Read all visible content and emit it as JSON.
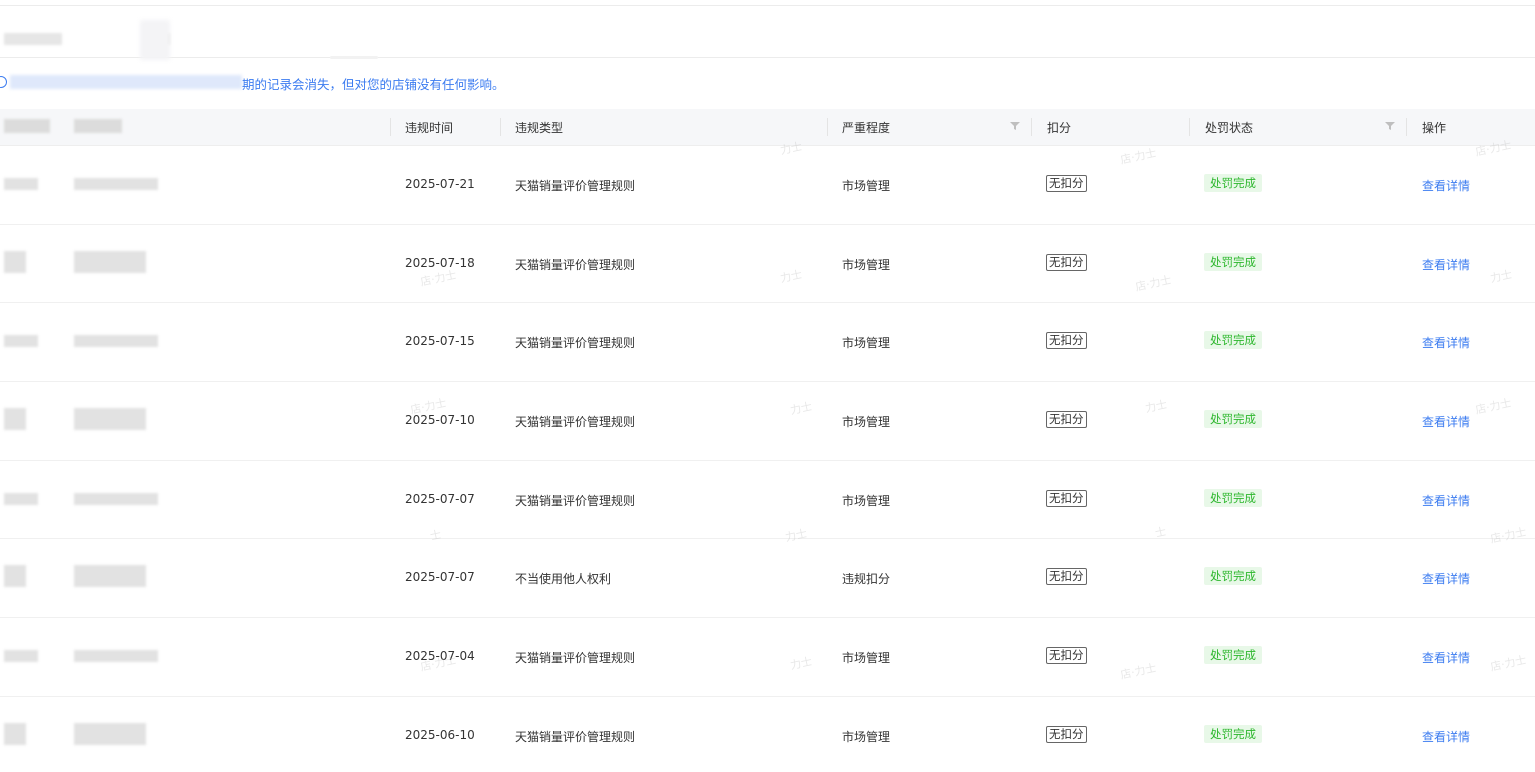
{
  "notice": {
    "text": "期的记录会消失，但对您的店铺没有任何影响。"
  },
  "table": {
    "headers": {
      "time": "违规时间",
      "type": "违规类型",
      "severity": "严重程度",
      "deduct": "扣分",
      "status": "处罚状态",
      "action": "操作"
    },
    "rows": [
      {
        "time": "2025-07-21",
        "type": "天猫销量评价管理规则",
        "severity": "市场管理",
        "deduct": "无扣分",
        "status": "处罚完成",
        "action": "查看详情"
      },
      {
        "time": "2025-07-18",
        "type": "天猫销量评价管理规则",
        "severity": "市场管理",
        "deduct": "无扣分",
        "status": "处罚完成",
        "action": "查看详情"
      },
      {
        "time": "2025-07-15",
        "type": "天猫销量评价管理规则",
        "severity": "市场管理",
        "deduct": "无扣分",
        "status": "处罚完成",
        "action": "查看详情"
      },
      {
        "time": "2025-07-10",
        "type": "天猫销量评价管理规则",
        "severity": "市场管理",
        "deduct": "无扣分",
        "status": "处罚完成",
        "action": "查看详情"
      },
      {
        "time": "2025-07-07",
        "type": "天猫销量评价管理规则",
        "severity": "市场管理",
        "deduct": "无扣分",
        "status": "处罚完成",
        "action": "查看详情"
      },
      {
        "time": "2025-07-07",
        "type": "不当使用他人权利",
        "severity": "违规扣分",
        "deduct": "无扣分",
        "status": "处罚完成",
        "action": "查看详情"
      },
      {
        "time": "2025-07-04",
        "type": "天猫销量评价管理规则",
        "severity": "市场管理",
        "deduct": "无扣分",
        "status": "处罚完成",
        "action": "查看详情"
      },
      {
        "time": "2025-06-10",
        "type": "天猫销量评价管理规则",
        "severity": "市场管理",
        "deduct": "无扣分",
        "status": "处罚完成",
        "action": "查看详情"
      }
    ]
  },
  "colors": {
    "link": "#3c7cf0",
    "status_bg": "#e8f8e8",
    "status_text": "#2db72d"
  }
}
